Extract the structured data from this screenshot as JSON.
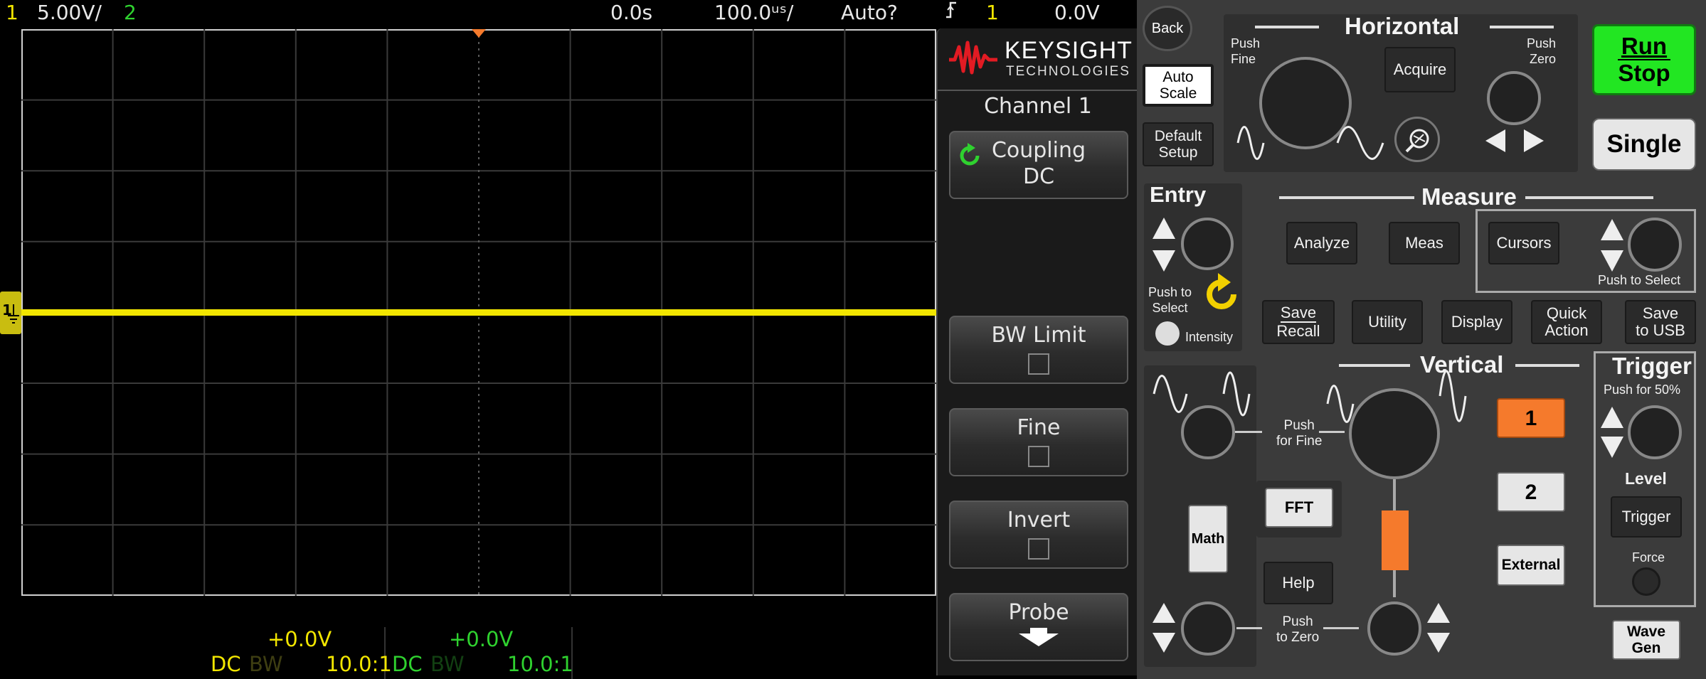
{
  "status_bar": {
    "ch1_number": "1",
    "ch1_scale": "5.00V/",
    "ch2_number": "2",
    "time_delay": "0.0s",
    "time_scale": "100.0ᵘˢ/",
    "trigger_mode": "Auto?",
    "trigger_slope_icon": "rising-edge",
    "trigger_source": "1",
    "trigger_level": "0.0V"
  },
  "channel_info": {
    "ch1": {
      "offset": "+0.0V",
      "coupling": "DC",
      "bw": "BW",
      "probe": "10.0:1",
      "color": "#f2e600"
    },
    "ch2": {
      "offset": "+0.0V",
      "coupling": "DC",
      "bw": "BW",
      "probe": "10.0:1",
      "color": "#2fd22f"
    }
  },
  "trace": {
    "ch1_marker": "1",
    "ground_icon": "ground-icon",
    "level_fraction_of_screen": 0.5
  },
  "menu": {
    "brand_name": "KEYSIGHT",
    "brand_sub": "TECHNOLOGIES",
    "title": "Channel 1",
    "softkeys": {
      "coupling": {
        "label": "Coupling",
        "value": "DC"
      },
      "bw_limit": {
        "label": "BW Limit",
        "checked": false
      },
      "fine": {
        "label": "Fine",
        "checked": false
      },
      "invert": {
        "label": "Invert",
        "checked": false
      },
      "probe": {
        "label": "Probe"
      }
    }
  },
  "panel": {
    "back": "Back",
    "auto_scale": [
      "Auto",
      "Scale"
    ],
    "default_setup": [
      "Default",
      "Setup"
    ],
    "horizontal": {
      "title": "Horizontal",
      "push_fine": [
        "Push",
        "Fine"
      ],
      "push_zero": [
        "Push",
        "Zero"
      ],
      "acquire": "Acquire"
    },
    "run_stop": [
      "Run",
      "Stop"
    ],
    "single": "Single",
    "entry": {
      "title": "Entry",
      "push_to_select": [
        "Push to",
        "Select"
      ],
      "intensity": "Intensity"
    },
    "measure": {
      "title": "Measure",
      "analyze": "Analyze",
      "meas": "Meas",
      "cursors": "Cursors",
      "push_to_select": "Push to Select"
    },
    "row_buttons": {
      "save_recall": [
        "Save",
        "Recall"
      ],
      "utility": "Utility",
      "display": "Display",
      "quick_action": [
        "Quick",
        "Action"
      ],
      "save_to_usb": [
        "Save",
        "to USB"
      ]
    },
    "vertical": {
      "title": "Vertical",
      "push_fine": [
        "Push",
        "for Fine"
      ],
      "push_zero": [
        "Push",
        "to Zero"
      ],
      "fft": "FFT",
      "math": "Math",
      "help": "Help",
      "ch1": "1",
      "ch2": "2",
      "external": "External"
    },
    "trigger": {
      "title": "Trigger",
      "push_50": "Push for 50%",
      "level": "Level",
      "trigger_btn": "Trigger",
      "force": "Force"
    },
    "wave_gen": [
      "Wave",
      "Gen"
    ],
    "colors": {
      "run_green": "#22e622",
      "channel1_orange": "#f57a2c",
      "panel_bg": "#3b3b3b"
    }
  }
}
